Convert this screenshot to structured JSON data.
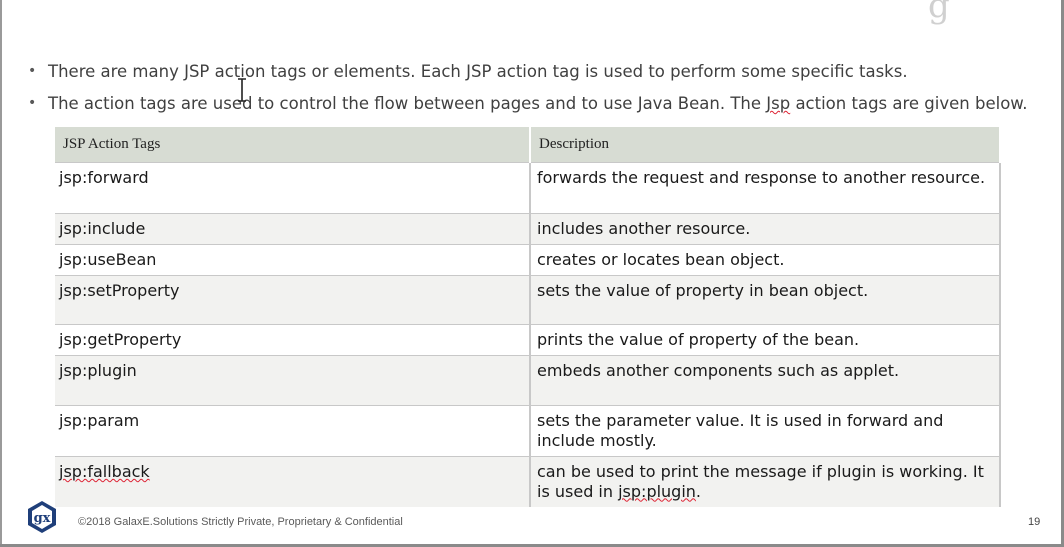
{
  "brand_mark": "g",
  "bullets": [
    "There are many JSP action tags or elements. Each JSP action tag is used to perform some specific tasks.",
    {
      "before": "The action tags are used to control the flow between pages and to use Java Bean. The ",
      "underlined": "Jsp",
      "after": " action tags are given below."
    }
  ],
  "table": {
    "headers": [
      "JSP Action Tags",
      "Description"
    ],
    "rows": [
      {
        "tag": "jsp:forward",
        "description": "forwards the request and response to another resource."
      },
      {
        "tag": "jsp:include",
        "description": "includes another resource."
      },
      {
        "tag": "jsp:useBean",
        "description": "creates or locates bean object."
      },
      {
        "tag": "jsp:setProperty",
        "description": "sets the value of property in bean object."
      },
      {
        "tag": "jsp:getProperty",
        "description": "prints the value of property of the bean."
      },
      {
        "tag": "jsp:plugin",
        "description": "embeds another components such as applet."
      },
      {
        "tag": "jsp:param",
        "description": "sets the parameter value. It is used in forward and include mostly."
      },
      {
        "tag": "jsp:fallback",
        "description_before": "can be used to print the message if plugin is working. It is used in ",
        "description_underlined": "jsp:plugin",
        "description_after": "."
      }
    ]
  },
  "footer": {
    "logo": "gx",
    "text": "©2018 GalaxE.Solutions Strictly Private, Proprietary & Confidential",
    "page_number": "19"
  },
  "colors": {
    "header_bg": "#d7dcd3",
    "alt_row_bg": "#f2f2f0",
    "logo_blue": "#1f3f7a"
  },
  "icons": {
    "cursor": "text-cursor-icon",
    "logo": "galaxe-logo-icon"
  }
}
